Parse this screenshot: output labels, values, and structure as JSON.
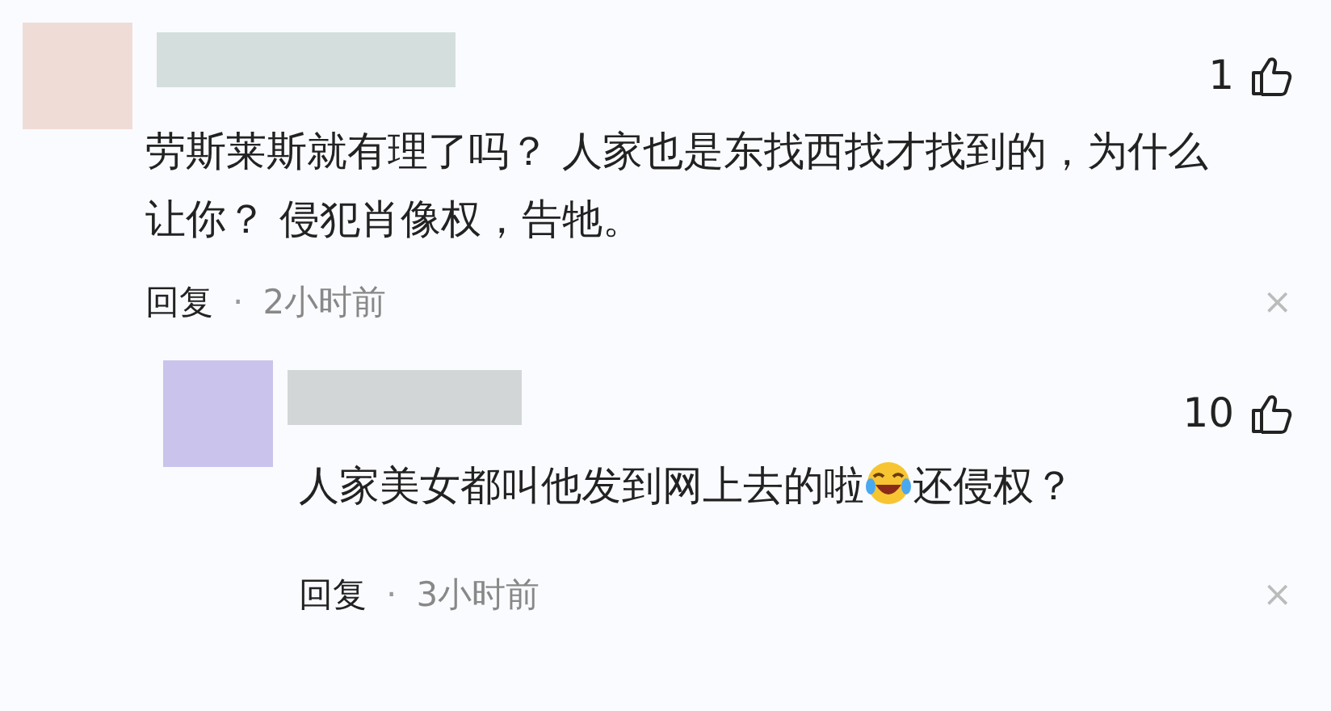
{
  "comments": [
    {
      "color": "#f0dcd6",
      "likes": "1",
      "segments": [
        {
          "kind": "text",
          "text": "劳斯莱斯就有理了吗？ 人家也是东找西找才找到的，为什么让你？ 侵犯肖像权，告牠。"
        }
      ],
      "reply": "回复",
      "dot": "·",
      "time": "2小时前",
      "close": "×",
      "nested": false
    },
    {
      "color": "#cac4ec",
      "likes": "10",
      "segments": [
        {
          "kind": "text",
          "text": "人家美女都叫他发到网上去的啦"
        },
        {
          "kind": "emoji"
        },
        {
          "kind": "text",
          "text": "还侵权？"
        }
      ],
      "reply": "回复",
      "dot": "·",
      "time": "3小时前",
      "close": "×",
      "nested": true
    }
  ]
}
